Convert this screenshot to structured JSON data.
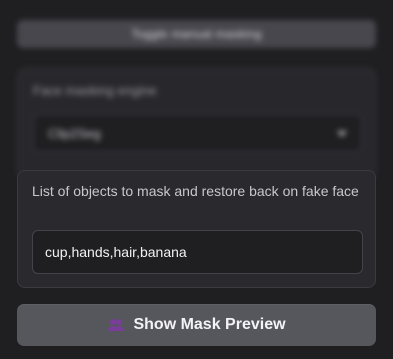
{
  "toggle_manual_masking": {
    "label": "Toggle manual masking"
  },
  "face_masking_engine": {
    "label": "Face masking engine",
    "selected": "Clip2Seg"
  },
  "objects_to_mask": {
    "label": "List of objects to mask and restore back on fake face",
    "value": "cup,hands,hair,banana"
  },
  "show_mask_preview": {
    "label": "Show Mask Preview",
    "icon": "people-icon"
  },
  "colors": {
    "background": "#1f1f22",
    "panel": "#2a2a2e",
    "button": "#56565d",
    "icon_purple": "#7a3d9b"
  }
}
